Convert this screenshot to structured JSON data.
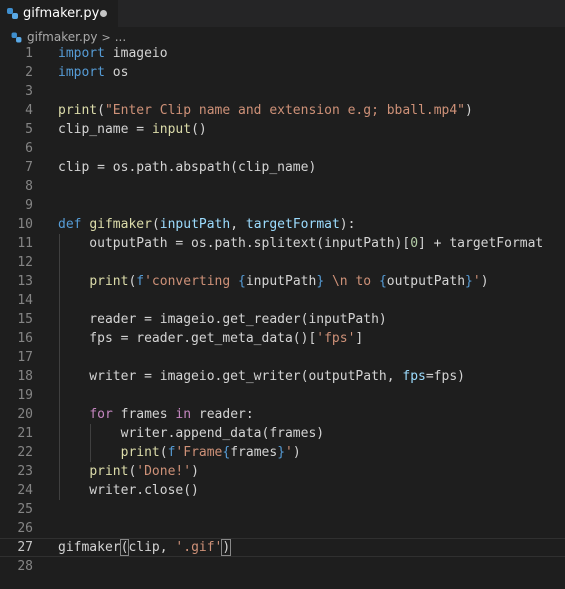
{
  "tab": {
    "title": "gifmaker.py",
    "icon": "python-file-icon",
    "unsaved_indicator": "dirty-dot-icon"
  },
  "breadcrumb": {
    "file": "gifmaker.py",
    "separator": ">",
    "more": "..."
  },
  "editor": {
    "current_line": 27,
    "lines": [
      {
        "n": "1",
        "tokens": [
          {
            "t": "import",
            "c": "kw"
          },
          {
            "t": " imageio",
            "c": "txt"
          }
        ]
      },
      {
        "n": "2",
        "tokens": [
          {
            "t": "import",
            "c": "kw"
          },
          {
            "t": " os",
            "c": "txt"
          }
        ]
      },
      {
        "n": "3",
        "tokens": []
      },
      {
        "n": "4",
        "tokens": [
          {
            "t": "print",
            "c": "fn"
          },
          {
            "t": "(",
            "c": "txt"
          },
          {
            "t": "\"Enter Clip name and extension e.g; bball.mp4\"",
            "c": "str"
          },
          {
            "t": ")",
            "c": "txt"
          }
        ]
      },
      {
        "n": "5",
        "tokens": [
          {
            "t": "clip_name",
            "c": "txt"
          },
          {
            "t": " = ",
            "c": "txt"
          },
          {
            "t": "input",
            "c": "fn"
          },
          {
            "t": "()",
            "c": "txt"
          }
        ]
      },
      {
        "n": "6",
        "tokens": []
      },
      {
        "n": "7",
        "tokens": [
          {
            "t": "clip = os.path.abspath(clip_name)",
            "c": "txt"
          }
        ]
      },
      {
        "n": "8",
        "tokens": []
      },
      {
        "n": "9",
        "tokens": []
      },
      {
        "n": "10",
        "tokens": [
          {
            "t": "def",
            "c": "kw"
          },
          {
            "t": " ",
            "c": "txt"
          },
          {
            "t": "gifmaker",
            "c": "fn"
          },
          {
            "t": "(",
            "c": "txt"
          },
          {
            "t": "inputPath",
            "c": "var"
          },
          {
            "t": ", ",
            "c": "txt"
          },
          {
            "t": "targetFormat",
            "c": "var"
          },
          {
            "t": "):",
            "c": "txt"
          }
        ]
      },
      {
        "n": "11",
        "tokens": [
          {
            "t": "    outputPath = os.path.splitext(inputPath)[",
            "c": "txt"
          },
          {
            "t": "0",
            "c": "num"
          },
          {
            "t": "] + targetFormat",
            "c": "txt"
          }
        ]
      },
      {
        "n": "12",
        "tokens": []
      },
      {
        "n": "13",
        "tokens": [
          {
            "t": "    ",
            "c": "txt"
          },
          {
            "t": "print",
            "c": "fn"
          },
          {
            "t": "(",
            "c": "txt"
          },
          {
            "t": "f",
            "c": "kw"
          },
          {
            "t": "'converting ",
            "c": "str"
          },
          {
            "t": "{",
            "c": "kw"
          },
          {
            "t": "inputPath",
            "c": "txt"
          },
          {
            "t": "}",
            "c": "kw"
          },
          {
            "t": " \\n to ",
            "c": "str"
          },
          {
            "t": "{",
            "c": "kw"
          },
          {
            "t": "outputPath",
            "c": "txt"
          },
          {
            "t": "}",
            "c": "kw"
          },
          {
            "t": "'",
            "c": "str"
          },
          {
            "t": ")",
            "c": "txt"
          }
        ]
      },
      {
        "n": "14",
        "tokens": []
      },
      {
        "n": "15",
        "tokens": [
          {
            "t": "    reader = imageio.get_reader(inputPath)",
            "c": "txt"
          }
        ]
      },
      {
        "n": "16",
        "tokens": [
          {
            "t": "    fps = reader.get_meta_data()[",
            "c": "txt"
          },
          {
            "t": "'fps'",
            "c": "str"
          },
          {
            "t": "]",
            "c": "txt"
          }
        ]
      },
      {
        "n": "17",
        "tokens": []
      },
      {
        "n": "18",
        "tokens": [
          {
            "t": "    writer = imageio.get_writer(outputPath, ",
            "c": "txt"
          },
          {
            "t": "fps",
            "c": "var"
          },
          {
            "t": "=fps)",
            "c": "txt"
          }
        ]
      },
      {
        "n": "19",
        "tokens": []
      },
      {
        "n": "20",
        "tokens": [
          {
            "t": "    ",
            "c": "txt"
          },
          {
            "t": "for",
            "c": "ctl"
          },
          {
            "t": " frames ",
            "c": "txt"
          },
          {
            "t": "in",
            "c": "ctl"
          },
          {
            "t": " reader:",
            "c": "txt"
          }
        ]
      },
      {
        "n": "21",
        "tokens": [
          {
            "t": "        writer.append_data(frames)",
            "c": "txt"
          }
        ]
      },
      {
        "n": "22",
        "tokens": [
          {
            "t": "        ",
            "c": "txt"
          },
          {
            "t": "print",
            "c": "fn"
          },
          {
            "t": "(",
            "c": "txt"
          },
          {
            "t": "f",
            "c": "kw"
          },
          {
            "t": "'Frame",
            "c": "str"
          },
          {
            "t": "{",
            "c": "kw"
          },
          {
            "t": "frames",
            "c": "txt"
          },
          {
            "t": "}",
            "c": "kw"
          },
          {
            "t": "'",
            "c": "str"
          },
          {
            "t": ")",
            "c": "txt"
          }
        ]
      },
      {
        "n": "23",
        "tokens": [
          {
            "t": "    ",
            "c": "txt"
          },
          {
            "t": "print",
            "c": "fn"
          },
          {
            "t": "(",
            "c": "txt"
          },
          {
            "t": "'Done!'",
            "c": "str"
          },
          {
            "t": ")",
            "c": "txt"
          }
        ]
      },
      {
        "n": "24",
        "tokens": [
          {
            "t": "    writer.close()",
            "c": "txt"
          }
        ]
      },
      {
        "n": "25",
        "tokens": []
      },
      {
        "n": "26",
        "tokens": []
      },
      {
        "n": "27",
        "tokens": [
          {
            "t": "gifmaker",
            "c": "txt"
          },
          {
            "t": "(",
            "c": "br"
          },
          {
            "t": "clip, ",
            "c": "txt"
          },
          {
            "t": "'.gif'",
            "c": "str"
          },
          {
            "t": ")",
            "c": "br"
          }
        ]
      },
      {
        "n": "28",
        "tokens": []
      }
    ]
  },
  "colors": {
    "background": "#1e1e1e",
    "tabbar": "#252526",
    "keyword": "#569cd6",
    "control": "#c586c0",
    "function": "#dcdcaa",
    "parameter": "#9cdcfe",
    "string": "#ce9178",
    "number": "#b5cea8",
    "line_number": "#858585"
  }
}
